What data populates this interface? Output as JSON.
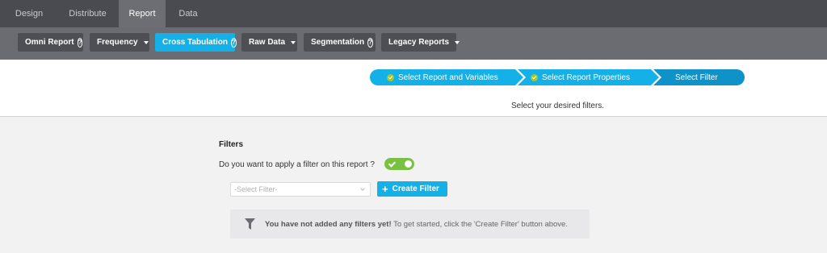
{
  "tabs": [
    "Design",
    "Distribute",
    "Report",
    "Data"
  ],
  "toolbar": {
    "omni_report": "Omni Report",
    "frequency": "Frequency",
    "cross_tabulation": "Cross Tabulation",
    "raw_data": "Raw Data",
    "segmentation": "Segmentation",
    "legacy_reports": "Legacy Reports"
  },
  "steps": [
    "Select Report and Variables",
    "Select Report Properties",
    "Select Filter"
  ],
  "subheader": "Select your desired filters.",
  "filters": {
    "title": "Filters",
    "question": "Do you want to apply a filter on this report ?",
    "select_placeholder": "-Select Filter-",
    "create_label": "Create Filter",
    "empty_strong": "You have not added any filters yet!",
    "empty_rest": " To get started, click the 'Create Filter' button above."
  },
  "colors": {
    "accent": "#13b1e8",
    "toggle_on": "#7ac143",
    "step_bg": "#13b1e8",
    "check": "#a8c52a"
  }
}
